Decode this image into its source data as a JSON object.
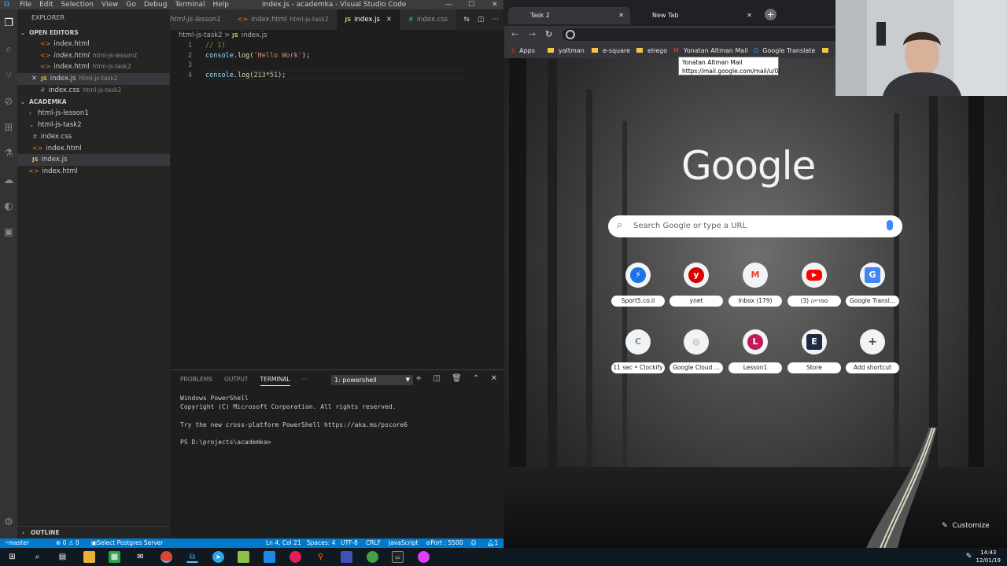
{
  "vscode": {
    "menu": [
      "File",
      "Edit",
      "Selection",
      "View",
      "Go",
      "Debug",
      "Terminal",
      "Help"
    ],
    "window_title": "index.js - academka - Visual Studio Code",
    "explorer_title": "EXPLORER",
    "open_editors_label": "OPEN EDITORS",
    "open_editors": [
      {
        "name": "index.html",
        "desc": "",
        "type": "html"
      },
      {
        "name": "index.html",
        "desc": "html-js-lesson1",
        "type": "html"
      },
      {
        "name": "index.html",
        "desc": "html-js-task2",
        "type": "html"
      },
      {
        "name": "index.js",
        "desc": "html-js-task2",
        "type": "js"
      },
      {
        "name": "index.css",
        "desc": "html-js-task2",
        "type": "css"
      }
    ],
    "workspace_label": "ACADEMKA",
    "tree": [
      {
        "name": "html-js-lesson1",
        "type": "folder-closed"
      },
      {
        "name": "html-js-task2",
        "type": "folder-open"
      },
      {
        "name": "index.css",
        "type": "css"
      },
      {
        "name": "index.html",
        "type": "html"
      },
      {
        "name": "index.js",
        "type": "js"
      },
      {
        "name": "index.html",
        "type": "html"
      }
    ],
    "outline_label": "OUTLINE",
    "tabs": [
      {
        "name": "html-js-lesson1",
        "desc": ""
      },
      {
        "name": "index.html",
        "desc": "html-js-task2"
      },
      {
        "name": "index.js",
        "desc": ""
      },
      {
        "name": "index.css",
        "desc": ""
      }
    ],
    "breadcrumb": {
      "folder": "html-js-task2",
      "sep": ">",
      "file": "index.js"
    },
    "code": {
      "l1": {
        "num": "1",
        "text": "// 1)"
      },
      "l2": {
        "num": "2",
        "obj": "console",
        "dot": ".",
        "fn": "log",
        "open": "(",
        "str": "'Hello Work'",
        "close": ");"
      },
      "l3": {
        "num": "3"
      },
      "l4": {
        "num": "4",
        "obj": "console",
        "dot": ".",
        "fn": "log",
        "open": "(",
        "n1": "213",
        "op": "*",
        "n2": "51",
        "close": ");"
      }
    },
    "panel_tabs": [
      "PROBLEMS",
      "OUTPUT",
      "TERMINAL",
      "···"
    ],
    "terminal_select": "1: powershell",
    "terminal": [
      "Windows PowerShell",
      "Copyright (C) Microsoft Corporation. All rights reserved.",
      "",
      "Try the new cross-platform PowerShell https://aka.ms/pscore6",
      "",
      "PS D:\\projects\\academka>"
    ],
    "status": {
      "branch": "master",
      "problems": "⊗ 0 ⚠ 0",
      "postgres": "Select Postgres Server",
      "position": "Ln 4, Col 21",
      "spaces": "Spaces: 4",
      "encoding": "UTF-8",
      "eol": "CRLF",
      "language": "JavaScript",
      "port": "Port : 5500",
      "bell": "1"
    }
  },
  "chrome": {
    "tabs": [
      {
        "title": "Task 2"
      },
      {
        "title": "New Tab"
      }
    ],
    "bookmarks": [
      "Apps",
      "yaltman",
      "e-square",
      "elrego",
      "Yonatan Altman Mail",
      "Google Translate"
    ],
    "tooltip": {
      "title": "Yonatan Altman Mail",
      "url": "https://mail.google.com/mail/u/0/"
    },
    "logo": "Google",
    "search_placeholder": "Search Google or type a URL",
    "shortcuts": [
      {
        "label": "Sport5.co.il",
        "glyph": "⚡",
        "color": "#1a73e8"
      },
      {
        "label": "ynet",
        "glyph": "y",
        "color": "#d50000"
      },
      {
        "label": "Inbox (179)",
        "glyph": "M",
        "color": "#ea4335"
      },
      {
        "label": "ספרייה (3)",
        "glyph": "▶",
        "color": "#ff0000"
      },
      {
        "label": "Google Transl...",
        "glyph": "G",
        "color": "#4285f4"
      },
      {
        "label": "11 sec • Clockify",
        "glyph": "C",
        "color": "#7d8da1"
      },
      {
        "label": "Google Cloud ...",
        "glyph": "◎",
        "color": "#9aa0a6"
      },
      {
        "label": "Lesson1",
        "glyph": "L",
        "color": "#c2185b"
      },
      {
        "label": "Store",
        "glyph": "E",
        "color": "#1f2a44"
      },
      {
        "label": "Add shortcut",
        "glyph": "+",
        "color": "#3c4043"
      }
    ],
    "customize": "Customize"
  },
  "taskbar": {
    "time": "14:43",
    "date": "12/01/19"
  }
}
